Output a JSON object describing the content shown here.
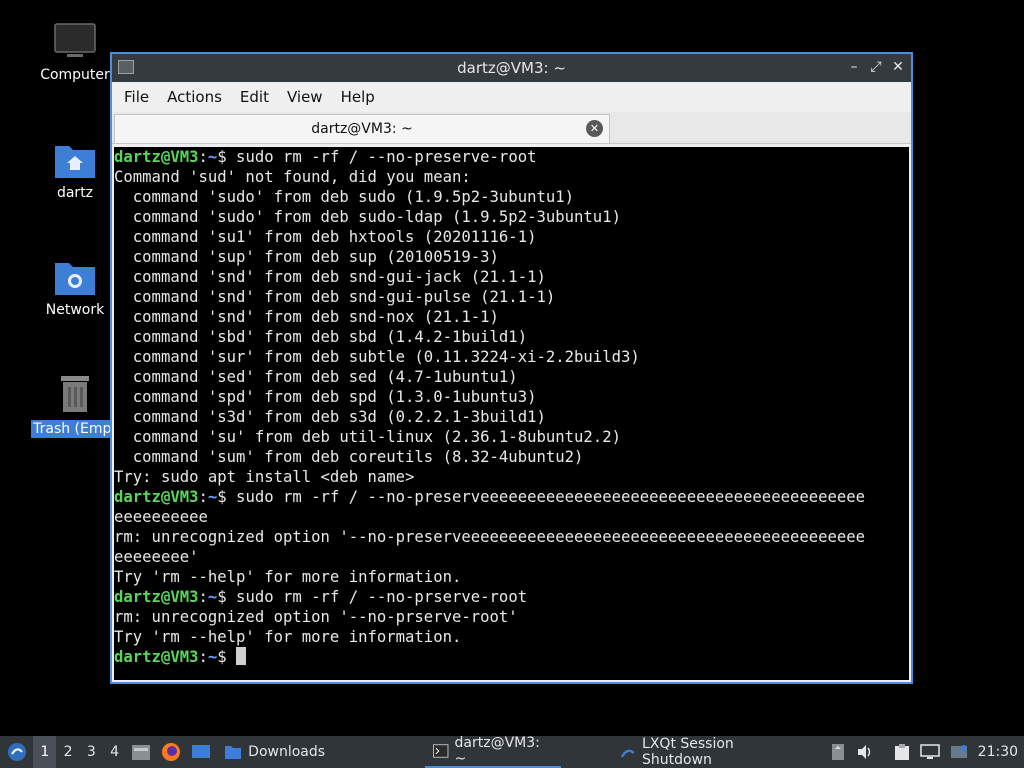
{
  "desktop": {
    "icons": [
      {
        "label": "Computer",
        "icon": "computer-icon"
      },
      {
        "label": "dartz",
        "icon": "home-folder-icon"
      },
      {
        "label": "Network",
        "icon": "network-folder-icon"
      },
      {
        "label": "Trash (Empt",
        "icon": "trash-icon"
      }
    ]
  },
  "window": {
    "title": "dartz@VM3: ~",
    "menu": [
      "File",
      "Actions",
      "Edit",
      "View",
      "Help"
    ],
    "tab_title": "dartz@VM3: ~"
  },
  "terminal": {
    "user_host": "dartz@VM3",
    "path": "~",
    "lines": [
      {
        "type": "prompt",
        "cmd": " sudo rm -rf / --no-preserve-root"
      },
      {
        "type": "out",
        "text": "Command 'sud' not found, did you mean:"
      },
      {
        "type": "out",
        "text": "  command 'sudo' from deb sudo (1.9.5p2-3ubuntu1)"
      },
      {
        "type": "out",
        "text": "  command 'sudo' from deb sudo-ldap (1.9.5p2-3ubuntu1)"
      },
      {
        "type": "out",
        "text": "  command 'su1' from deb hxtools (20201116-1)"
      },
      {
        "type": "out",
        "text": "  command 'sup' from deb sup (20100519-3)"
      },
      {
        "type": "out",
        "text": "  command 'snd' from deb snd-gui-jack (21.1-1)"
      },
      {
        "type": "out",
        "text": "  command 'snd' from deb snd-gui-pulse (21.1-1)"
      },
      {
        "type": "out",
        "text": "  command 'snd' from deb snd-nox (21.1-1)"
      },
      {
        "type": "out",
        "text": "  command 'sbd' from deb sbd (1.4.2-1build1)"
      },
      {
        "type": "out",
        "text": "  command 'sur' from deb subtle (0.11.3224-xi-2.2build3)"
      },
      {
        "type": "out",
        "text": "  command 'sed' from deb sed (4.7-1ubuntu1)"
      },
      {
        "type": "out",
        "text": "  command 'spd' from deb spd (1.3.0-1ubuntu3)"
      },
      {
        "type": "out",
        "text": "  command 's3d' from deb s3d (0.2.2.1-3build1)"
      },
      {
        "type": "out",
        "text": "  command 'su' from deb util-linux (2.36.1-8ubuntu2.2)"
      },
      {
        "type": "out",
        "text": "  command 'sum' from deb coreutils (8.32-4ubuntu2)"
      },
      {
        "type": "out",
        "text": "Try: sudo apt install <deb name>"
      },
      {
        "type": "prompt",
        "cmd": " sudo rm -rf / --no-preserveeeeeeeeeeeeeeeeeeeeeeeeeeeeeeeeeeeeeeeee"
      },
      {
        "type": "out",
        "text": "eeeeeeeeee"
      },
      {
        "type": "out",
        "text": "rm: unrecognized option '--no-preserveeeeeeeeeeeeeeeeeeeeeeeeeeeeeeeeeeeeeeeeeee"
      },
      {
        "type": "out",
        "text": "eeeeeeee'"
      },
      {
        "type": "out",
        "text": "Try 'rm --help' for more information."
      },
      {
        "type": "prompt",
        "cmd": " sudo rm -rf / --no-prserve-root"
      },
      {
        "type": "out",
        "text": "rm: unrecognized option '--no-prserve-root'"
      },
      {
        "type": "out",
        "text": "Try 'rm --help' for more information."
      },
      {
        "type": "prompt_cursor",
        "cmd": " "
      }
    ]
  },
  "taskbar": {
    "workspaces": [
      "1",
      "2",
      "3",
      "4"
    ],
    "active_workspace": "1",
    "tasks": [
      {
        "label": "Downloads",
        "icon": "folder-icon"
      },
      {
        "label": "dartz@VM3: ~",
        "icon": "terminal-icon"
      },
      {
        "label": "LXQt Session Shutdown",
        "icon": "lxqt-icon"
      }
    ],
    "clock": "21:30"
  },
  "colors": {
    "prompt_user": "#5ad65a",
    "prompt_path": "#6aa0ff",
    "window_border": "#4a90d9",
    "taskbar_bg": "#30353a",
    "selection": "#3d7fd6"
  }
}
